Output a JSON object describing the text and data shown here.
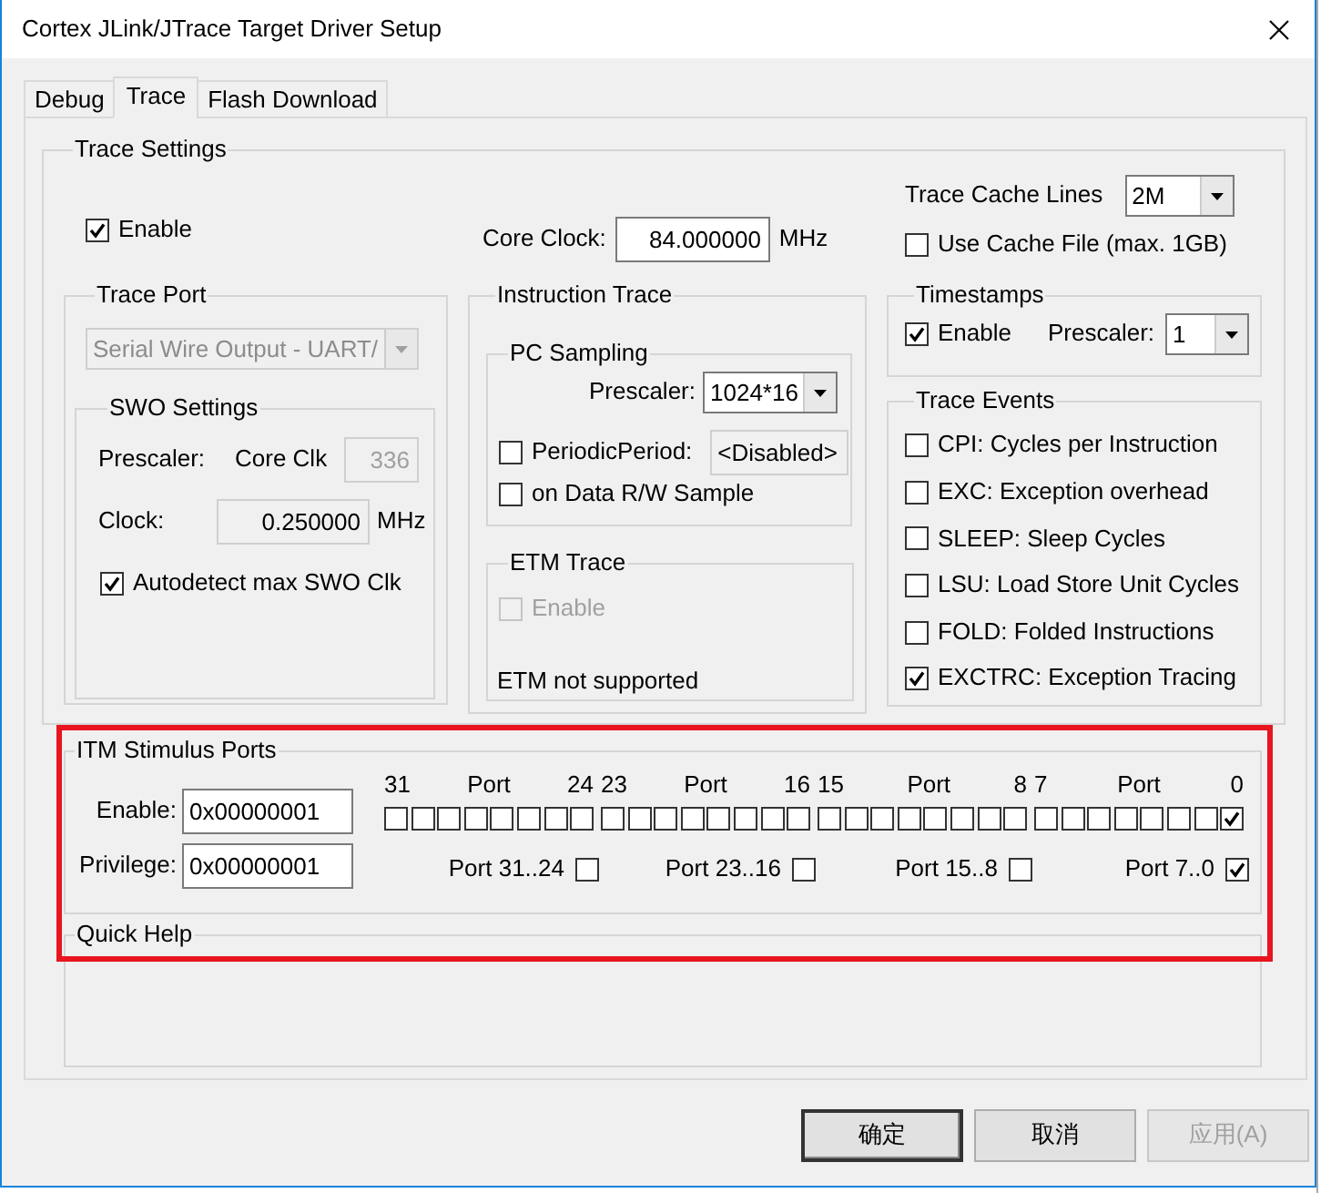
{
  "window": {
    "title": "Cortex JLink/JTrace Target Driver Setup"
  },
  "tabs": [
    {
      "label": "Debug",
      "selected": false
    },
    {
      "label": "Trace",
      "selected": true
    },
    {
      "label": "Flash Download",
      "selected": false
    }
  ],
  "trace_settings": {
    "title": "Trace Settings",
    "enable": {
      "label": "Enable",
      "checked": true
    },
    "core_clock": {
      "label": "Core Clock:",
      "value": "84.000000",
      "unit": "MHz"
    },
    "cache_lines": {
      "label": "Trace Cache Lines",
      "value": "2M"
    },
    "use_cache_file": {
      "label": "Use Cache File (max. 1GB)",
      "checked": false
    },
    "trace_port": {
      "title": "Trace Port",
      "value": "Serial Wire Output - UART/",
      "disabled": true,
      "swo": {
        "title": "SWO Settings",
        "prescaler_label": "Prescaler:",
        "core_clk_label": "Core Clk",
        "prescaler_value": "336",
        "clock_label": "Clock:",
        "clock_value": "0.250000",
        "clock_unit": "MHz",
        "autodetect": {
          "label": "Autodetect max SWO Clk",
          "checked": true
        }
      }
    },
    "instruction_trace": {
      "title": "Instruction Trace",
      "pc_sampling": {
        "title": "PC Sampling",
        "prescaler_label": "Prescaler:",
        "prescaler": {
          "value": "1024*16"
        },
        "periodic": {
          "label": "PeriodicPeriod:",
          "checked": false
        },
        "period_value": "<Disabled>",
        "data_rw": {
          "label": "on Data R/W Sample",
          "checked": false
        }
      },
      "etm": {
        "title": "ETM Trace",
        "enable": {
          "label": "Enable",
          "checked": false,
          "disabled": true
        },
        "note": "ETM not supported"
      }
    },
    "timestamps": {
      "title": "Timestamps",
      "enable": {
        "label": "Enable",
        "checked": true
      },
      "prescaler_label": "Prescaler:",
      "prescaler": {
        "value": "1"
      }
    },
    "trace_events": {
      "title": "Trace Events",
      "items": [
        {
          "label": "CPI: Cycles per Instruction",
          "checked": false
        },
        {
          "label": "EXC: Exception overhead",
          "checked": false
        },
        {
          "label": "SLEEP: Sleep Cycles",
          "checked": false
        },
        {
          "label": "LSU: Load Store Unit Cycles",
          "checked": false
        },
        {
          "label": "FOLD: Folded Instructions",
          "checked": false
        },
        {
          "label": "EXCTRC: Exception Tracing",
          "checked": true
        }
      ]
    }
  },
  "itm": {
    "title": "ITM Stimulus Ports",
    "enable_label": "Enable:",
    "enable_value": "0x00000001",
    "privilege_label": "Privilege:",
    "privilege_value": "0x00000001",
    "groups": [
      {
        "high": "31",
        "title": "Port",
        "low": "24",
        "bits": [
          {
            "checked": false
          },
          {
            "checked": false
          },
          {
            "checked": false
          },
          {
            "checked": false
          },
          {
            "checked": false
          },
          {
            "checked": false
          },
          {
            "checked": false
          },
          {
            "checked": false
          }
        ],
        "privilege": {
          "label": "Port 31..24",
          "checked": false
        }
      },
      {
        "high": "23",
        "title": "Port",
        "low": "16",
        "bits": [
          {
            "checked": false
          },
          {
            "checked": false
          },
          {
            "checked": false
          },
          {
            "checked": false
          },
          {
            "checked": false
          },
          {
            "checked": false
          },
          {
            "checked": false
          },
          {
            "checked": false
          }
        ],
        "privilege": {
          "label": "Port 23..16",
          "checked": false
        }
      },
      {
        "high": "15",
        "title": "Port",
        "low": "8",
        "bits": [
          {
            "checked": false
          },
          {
            "checked": false
          },
          {
            "checked": false
          },
          {
            "checked": false
          },
          {
            "checked": false
          },
          {
            "checked": false
          },
          {
            "checked": false
          },
          {
            "checked": false
          }
        ],
        "privilege": {
          "label": "Port 15..8",
          "checked": false
        }
      },
      {
        "high": "7",
        "title": "Port",
        "low": "0",
        "bits": [
          {
            "checked": false
          },
          {
            "checked": false
          },
          {
            "checked": false
          },
          {
            "checked": false
          },
          {
            "checked": false
          },
          {
            "checked": false
          },
          {
            "checked": false
          },
          {
            "checked": true
          }
        ],
        "privilege": {
          "label": "Port 7..0",
          "checked": true
        }
      }
    ]
  },
  "quick_help": {
    "title": "Quick Help"
  },
  "buttons": [
    {
      "label": "确定",
      "default": true,
      "disabled": false
    },
    {
      "label": "取消",
      "default": false,
      "disabled": false
    },
    {
      "label": "应用(A)",
      "default": false,
      "disabled": true
    }
  ]
}
